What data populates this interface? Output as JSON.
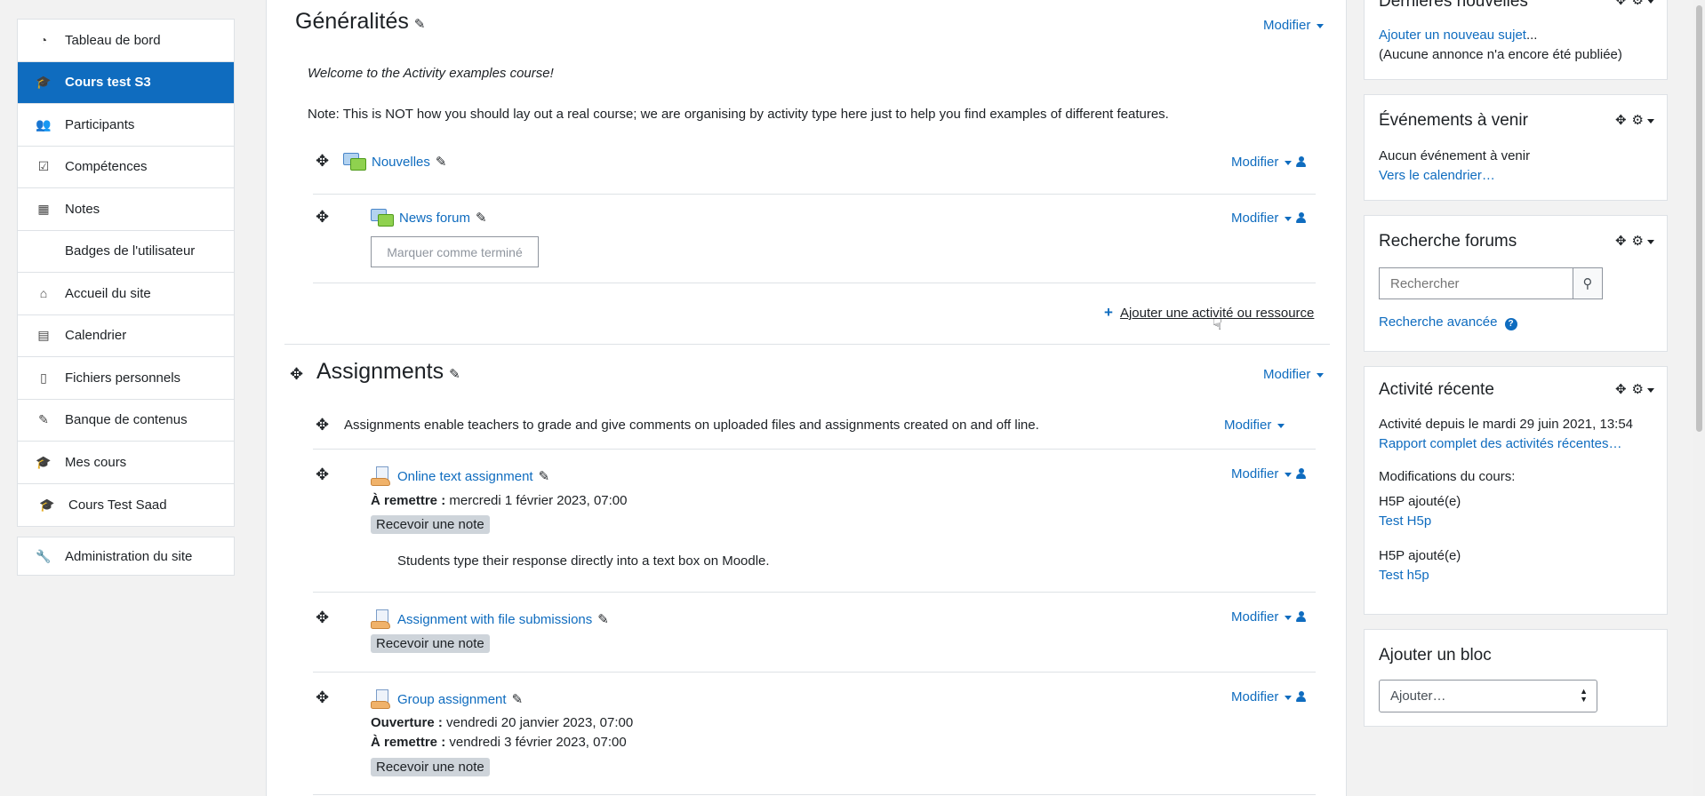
{
  "nav": {
    "group1": [
      {
        "label": "Tableau de bord",
        "icon": "dashboard-icon"
      },
      {
        "label": "Cours test S3",
        "icon": "graduation-cap-icon",
        "active": true
      },
      {
        "label": "Participants",
        "icon": "users-icon"
      },
      {
        "label": "Compétences",
        "icon": "checkbox-icon"
      },
      {
        "label": "Notes",
        "icon": "table-icon"
      },
      {
        "label": "Badges de l'utilisateur",
        "icon": ""
      },
      {
        "label": "Accueil du site",
        "icon": "home-icon"
      },
      {
        "label": "Calendrier",
        "icon": "calendar-icon"
      },
      {
        "label": "Fichiers personnels",
        "icon": "file-icon"
      },
      {
        "label": "Banque de contenus",
        "icon": "paintbrush-icon"
      },
      {
        "label": "Mes cours",
        "icon": "graduation-cap-icon"
      },
      {
        "label": "Cours Test Saad",
        "icon": "graduation-cap-icon"
      }
    ],
    "admin": {
      "label": "Administration du site",
      "icon": "wrench-icon"
    }
  },
  "main": {
    "modifier": "Modifier",
    "generalites": {
      "title": "Généralités",
      "welcome": "Welcome to the Activity examples course!",
      "note": "Note: This is NOT how you should lay out a real course; we are organising by activity type here just to help you find examples of different features.",
      "nouvelles": "Nouvelles",
      "news_forum": "News forum",
      "mark_done": "Marquer comme terminé",
      "add_activity": "Ajouter une activité ou ressource"
    },
    "assignments": {
      "title": "Assignments",
      "desc": "Assignments enable teachers to grade and give comments on uploaded files and assignments created on and off line.",
      "online": {
        "name": "Online text assignment",
        "due_label": "À remettre :",
        "due": "mercredi 1 février 2023, 07:00",
        "badge": "Recevoir une note",
        "desc": "Students type their response directly into a text box on Moodle."
      },
      "file": {
        "name": "Assignment with file submissions",
        "badge": "Recevoir une note"
      },
      "group": {
        "name": "Group assignment",
        "open_label": "Ouverture :",
        "open": "vendredi 20 janvier 2023, 07:00",
        "due_label": "À remettre :",
        "due": "vendredi 3 février 2023, 07:00",
        "badge": "Recevoir une note"
      }
    }
  },
  "blocks": {
    "news": {
      "title": "Dernières nouvelles",
      "add": "Ajouter un nouveau sujet",
      "ellipsis": "...",
      "empty": "(Aucune annonce n'a encore été publiée)"
    },
    "events": {
      "title": "Événements à venir",
      "none": "Aucun événement à venir",
      "calendar": "Vers le calendrier…"
    },
    "search": {
      "title": "Recherche forums",
      "placeholder": "Rechercher",
      "advanced": "Recherche avancée"
    },
    "recent": {
      "title": "Activité récente",
      "since": "Activité depuis le mardi 29 juin 2021, 13:54",
      "full_report": "Rapport complet des activités récentes…",
      "changes": "Modifications du cours:",
      "item1_label": "H5P ajouté(e)",
      "item1_link": "Test H5p",
      "item2_label": "H5P ajouté(e)",
      "item2_link": "Test h5p"
    },
    "addblock": {
      "title": "Ajouter un bloc",
      "select": "Ajouter…"
    }
  }
}
